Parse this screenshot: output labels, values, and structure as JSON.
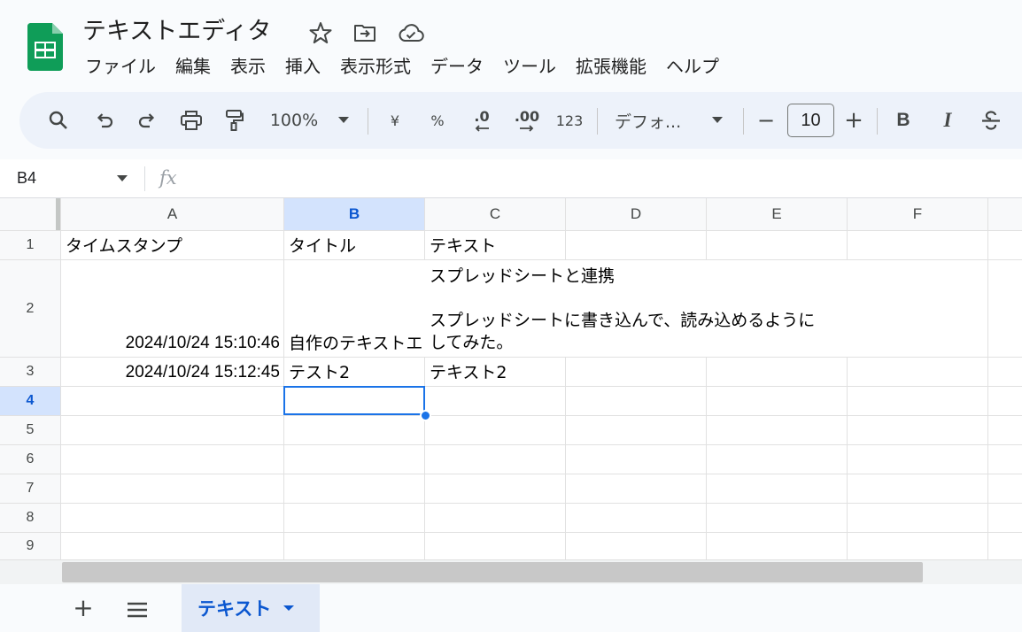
{
  "app": {
    "title": "テキストエディタ",
    "icons": [
      "sheets-logo",
      "star-icon",
      "move-folder-icon",
      "cloud-saved-icon"
    ]
  },
  "menu": [
    "ファイル",
    "編集",
    "表示",
    "挿入",
    "表示形式",
    "データ",
    "ツール",
    "拡張機能",
    "ヘルプ"
  ],
  "toolbar": {
    "zoom": "100%",
    "currency": "¥",
    "percent": "%",
    "decrease_decimal": ".0",
    "increase_decimal": ".00",
    "number_format": "123",
    "font_family": "デフォ...",
    "font_size": "10",
    "minus": "−",
    "plus": "+",
    "bold": "B",
    "italic": "I",
    "icons": [
      "search-icon",
      "undo-icon",
      "redo-icon",
      "print-icon",
      "paint-format-icon",
      "strikethrough-icon"
    ]
  },
  "formula_bar": {
    "name_box": "B4",
    "fx": "fx",
    "content": ""
  },
  "grid": {
    "columns": [
      "A",
      "B",
      "C",
      "D",
      "E",
      "F"
    ],
    "selected_column": "B",
    "rows": [
      "1",
      "2",
      "3",
      "4",
      "5",
      "6",
      "7",
      "8",
      "9"
    ],
    "selected_row": "4",
    "cells": {
      "A1": "タイムスタンプ",
      "B1": "タイトル",
      "C1": "テキスト",
      "A2": "2024/10/24 15:10:46",
      "B2": "自作のテキストエ",
      "C2_line1": "スプレッドシートと連携",
      "C2_line2": "スプレッドシートに書き込んで、読み込めるように",
      "C2_line3": "してみた。",
      "A3": "2024/10/24 15:12:45",
      "B3": "テスト2",
      "C3": "テキスト2"
    }
  },
  "sheets": {
    "add_label": "+",
    "tabs": [
      "テキスト"
    ],
    "active_tab": "テキスト"
  },
  "colors": {
    "accent": "#0b57d0",
    "selection": "#1a73e8",
    "header_selected_bg": "#d3e3fd",
    "toolbar_bg": "#edf2fa",
    "logo_green": "#0f9d58"
  }
}
